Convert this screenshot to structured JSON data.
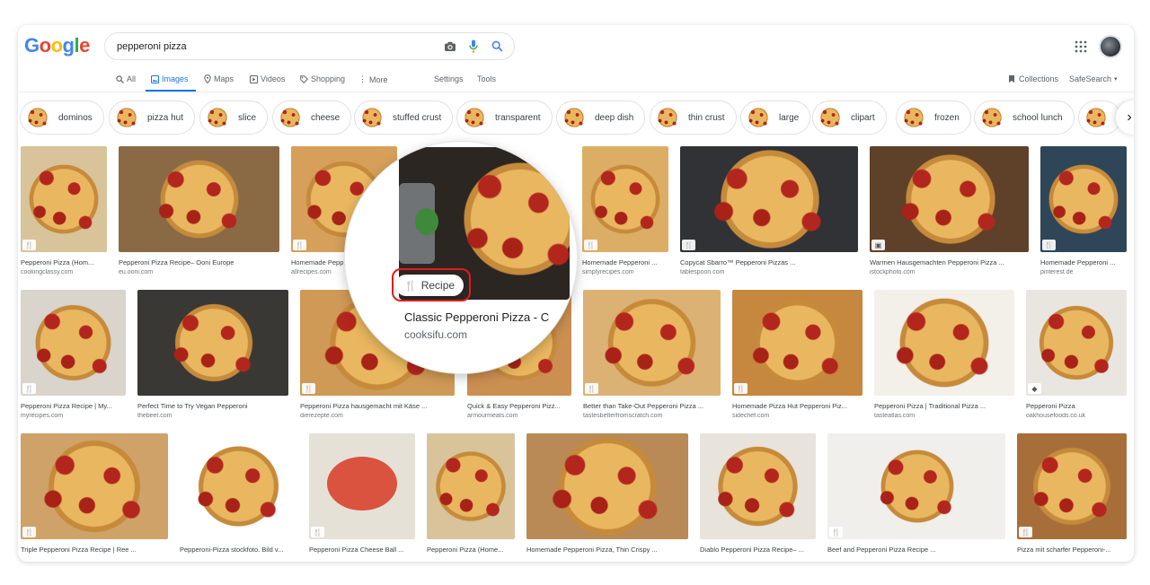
{
  "search": {
    "query": "pepperoni pizza"
  },
  "logo": [
    "G",
    "o",
    "o",
    "g",
    "l",
    "e"
  ],
  "logo_colors": [
    "#4285F4",
    "#EA4335",
    "#FBBC05",
    "#4285F4",
    "#34A853",
    "#EA4335"
  ],
  "tabs": [
    {
      "label": "All"
    },
    {
      "label": "Images"
    },
    {
      "label": "Maps"
    },
    {
      "label": "Videos"
    },
    {
      "label": "Shopping"
    },
    {
      "label": "More"
    },
    {
      "label": "Settings"
    },
    {
      "label": "Tools"
    }
  ],
  "right_tools": {
    "collections": "Collections",
    "safesearch": "SafeSearch"
  },
  "chips": [
    "dominos",
    "pizza hut",
    "slice",
    "cheese",
    "stuffed crust",
    "transparent",
    "deep dish",
    "thin crust",
    "large",
    "clipart",
    "frozen",
    "school lunch"
  ],
  "results": {
    "row1": [
      {
        "title": "Pepperoni Pizza (Hom...",
        "source": "cookingclassy.com"
      },
      {
        "title": "Pepperoni Pizza Recipe– Ooni Europe",
        "source": "eu.ooni.com"
      },
      {
        "title": "Homemade Pepp...",
        "source": "allrecipes.com"
      },
      {
        "title": "Homemade Pepperoni ...",
        "source": "simplyrecipes.com"
      },
      {
        "title": "Copycat Sbarro™ Pepperoni Pizzas ...",
        "source": "tablespoon.com"
      },
      {
        "title": "Warmen Hausgemachten Pepperoni Pizza ...",
        "source": "istockphoto.com"
      },
      {
        "title": "Homemade Pepperoni ...",
        "source": "pinterest.de"
      }
    ],
    "row2": [
      {
        "title": "Pepperoni Pizza Recipe | My...",
        "source": "myrecipes.com"
      },
      {
        "title": "Perfect Time to Try Vegan Pepperoni",
        "source": "thebeet.com"
      },
      {
        "title": "Pepperoni Pizza hausgemacht mit Käse ...",
        "source": "dierezepte.com"
      },
      {
        "title": "Quick & Easy Pepperoni Pizz...",
        "source": "armourmeats.com"
      },
      {
        "title": "Better than Take-Out Pepperoni Pizza ...",
        "source": "tastesbetterfromscratch.com"
      },
      {
        "title": "Homemade Pizza Hut Pepperoni Piz...",
        "source": "sidechef.com"
      },
      {
        "title": "Pepperoni Pizza | Traditional Pizza ...",
        "source": "tasteatlas.com"
      },
      {
        "title": "Pepperoni Pizza",
        "source": "oakhousefoods.co.uk"
      }
    ],
    "row3": [
      {
        "title": "Triple Pepperoni Pizza Recipe | Ree ...",
        "source": ""
      },
      {
        "title": "Pepperoni-Pizza stockfoto. Bild v...",
        "source": ""
      },
      {
        "title": "Pepperoni Pizza Cheese Ball ...",
        "source": ""
      },
      {
        "title": "Pepperoni Pizza (Home...",
        "source": ""
      },
      {
        "title": "Homemade Pepperoni Pizza, Thin Crispy ...",
        "source": ""
      },
      {
        "title": "Diablo Pepperoni Pizza Recipe– ...",
        "source": ""
      },
      {
        "title": "Beef and Pepperoni Pizza Recipe ...",
        "source": ""
      },
      {
        "title": "Pizza mit scharfer Pepperoni-...",
        "source": ""
      }
    ]
  },
  "magnifier": {
    "badge": "Recipe",
    "title": "Classic Pepperoni Pizza - C",
    "source": "cooksifu.com",
    "highlight_color": "#e21b1b"
  },
  "icons": [
    "camera-icon",
    "mic-icon",
    "search-icon",
    "apps-icon",
    "recipe-icon",
    "chevron-right-icon"
  ],
  "accent_color": "#1a73e8"
}
